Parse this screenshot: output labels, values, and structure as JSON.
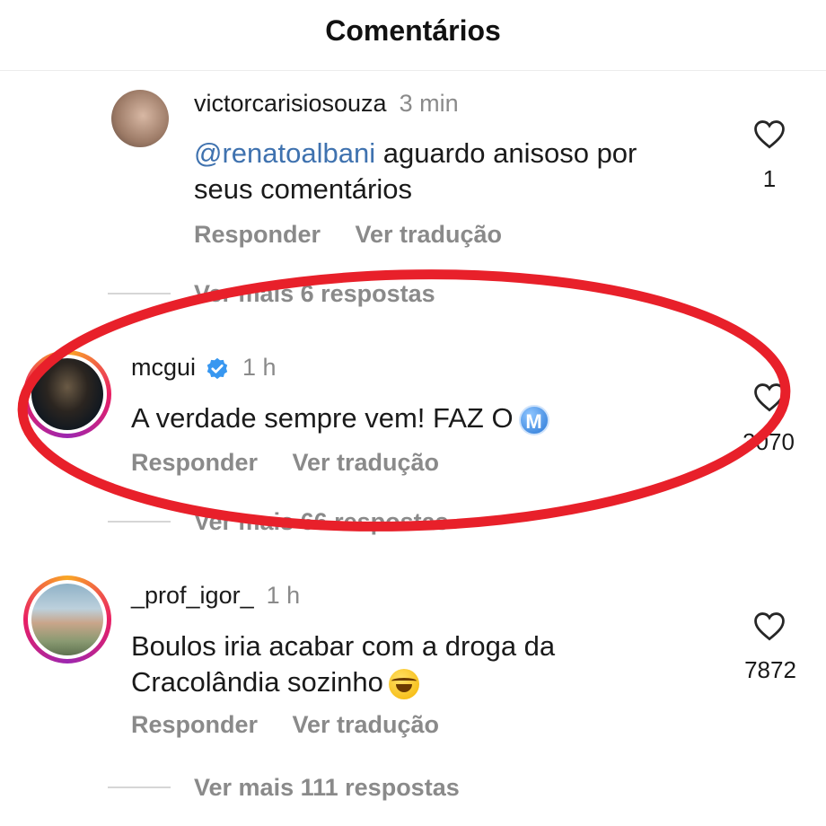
{
  "header": {
    "title": "Comentários"
  },
  "comments": [
    {
      "username": "victorcarisiosouza",
      "time": "3 min",
      "mention": "@renatoalbani",
      "text_line1": " aguardo anisoso por",
      "text_line2": "seus comentários",
      "likes": "1",
      "reply_label": "Responder",
      "translate_label": "Ver tradução",
      "more_replies": "Ver mais 6 respostas"
    },
    {
      "username": "mcgui",
      "verified": true,
      "time": "1 h",
      "text": "A verdade sempre vem! FAZ O",
      "badge_letter": "M",
      "likes": "3070",
      "reply_label": "Responder",
      "translate_label": "Ver tradução",
      "more_replies": "Ver mais 66 respostas"
    },
    {
      "username": "_prof_igor_",
      "time": "1 h",
      "text_line1": "Boulos iria acabar com a droga da",
      "text_line2": "Cracolândia sozinho",
      "emoji": "face-with-tears-of-joy",
      "likes": "7872",
      "reply_label": "Responder",
      "translate_label": "Ver tradução",
      "more_replies": "Ver mais 111 respostas"
    }
  ],
  "annotation": {
    "shape": "ellipse",
    "color": "#e8202a"
  },
  "colors": {
    "muted": "#8a8a8a",
    "mention": "#3f72af",
    "verified": "#3897f0"
  }
}
